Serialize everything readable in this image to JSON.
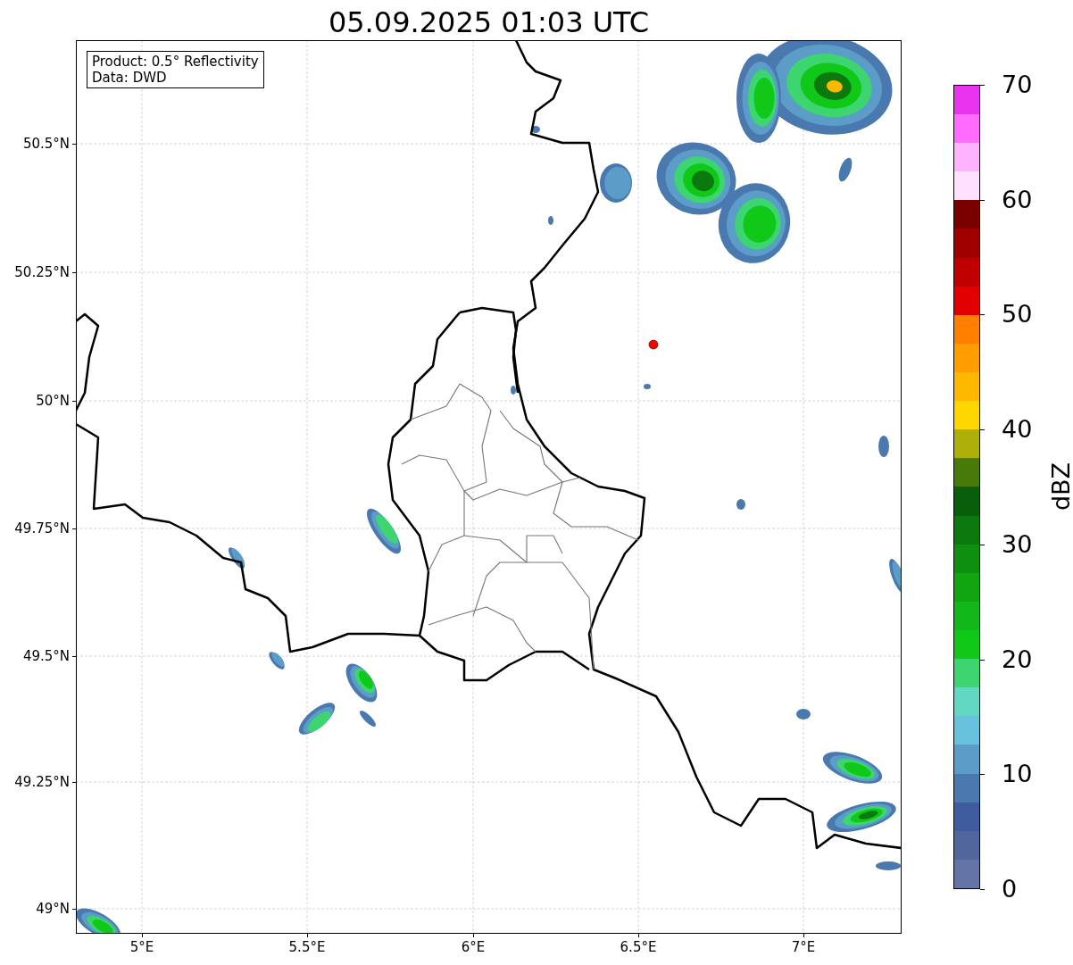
{
  "title": "05.09.2025 01:03 UTC",
  "map": {
    "info_lines": [
      "Product: 0.5° Reflectivity",
      "Data: DWD"
    ],
    "x_tick_labels": [
      "5°E",
      "5.5°E",
      "6°E",
      "6.5°E",
      "7°E"
    ],
    "y_tick_labels": [
      "50.5°N",
      "50.25°N",
      "50°N",
      "49.75°N",
      "49.5°N",
      "49.25°N",
      "49°N"
    ]
  },
  "colorbar": {
    "label": "dBZ",
    "tick_labels": [
      "70",
      "60",
      "50",
      "40",
      "30",
      "20",
      "10",
      "0"
    ],
    "bands": [
      {
        "color": "#6474a6"
      },
      {
        "color": "#52669e"
      },
      {
        "color": "#405ca0"
      },
      {
        "color": "#4a79b0"
      },
      {
        "color": "#5b9cc8"
      },
      {
        "color": "#67c3dd"
      },
      {
        "color": "#62d7c2"
      },
      {
        "color": "#3dd56f"
      },
      {
        "color": "#10c818"
      },
      {
        "color": "#12b81a"
      },
      {
        "color": "#11a511"
      },
      {
        "color": "#0f8f10"
      },
      {
        "color": "#0b790d"
      },
      {
        "color": "#095e0b"
      },
      {
        "color": "#487a0a"
      },
      {
        "color": "#aeb00a"
      },
      {
        "color": "#ffd700"
      },
      {
        "color": "#ffb800"
      },
      {
        "color": "#ff9c00"
      },
      {
        "color": "#ff7f00"
      },
      {
        "color": "#e20000"
      },
      {
        "color": "#c00000"
      },
      {
        "color": "#a00000"
      },
      {
        "color": "#7a0000"
      },
      {
        "color": "#ffe0ff"
      },
      {
        "color": "#ffb3ff"
      },
      {
        "color": "#ff6cff"
      },
      {
        "color": "#e933ef"
      }
    ]
  }
}
